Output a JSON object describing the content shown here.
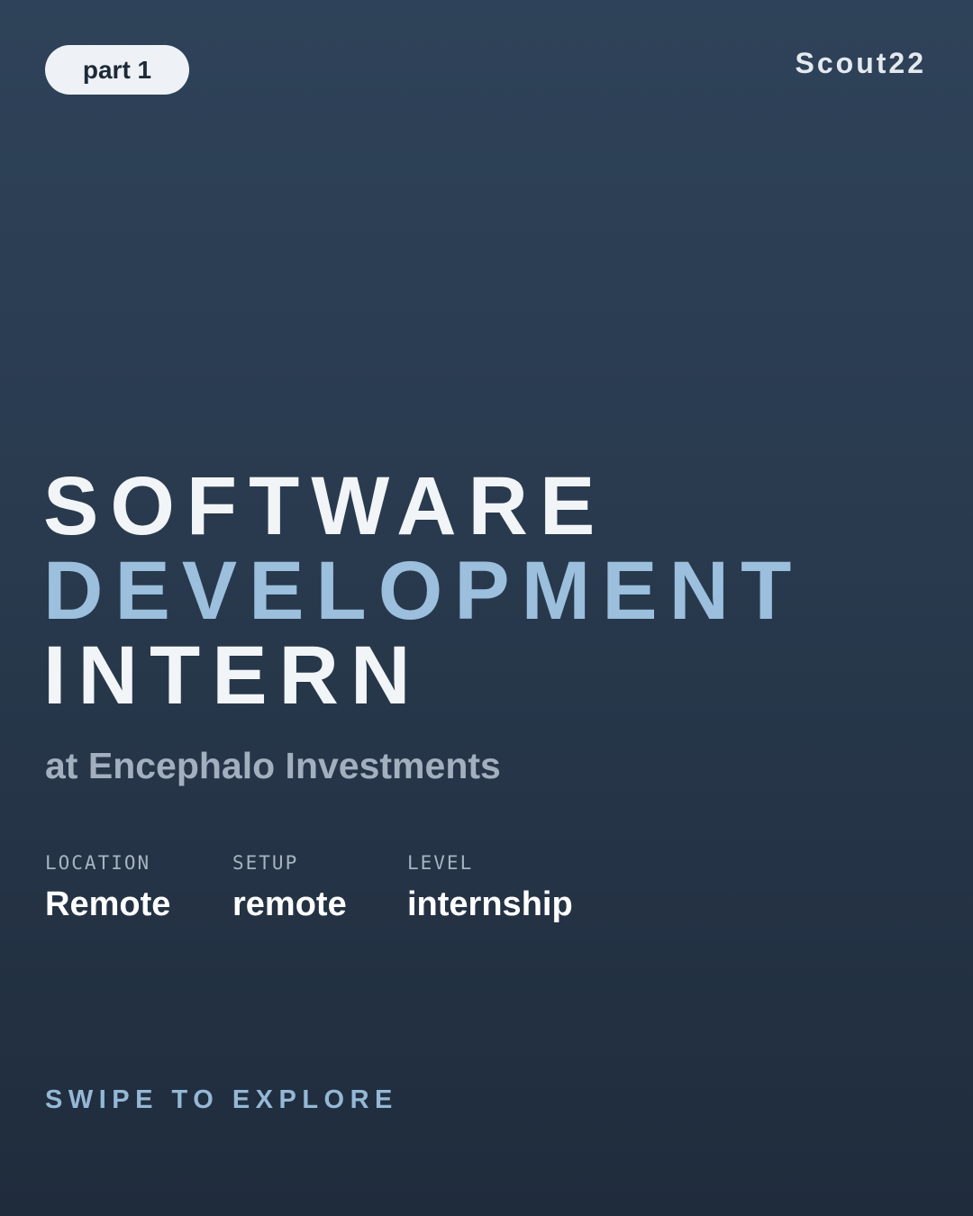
{
  "header": {
    "badge": "part 1",
    "brand": "Scout22"
  },
  "job": {
    "title_lines": [
      "SOFTWARE",
      "DEVELOPMENT",
      "INTERN"
    ],
    "company": "at Encephalo Investments"
  },
  "details": [
    {
      "label": "LOCATION",
      "value": "Remote"
    },
    {
      "label": "SETUP",
      "value": "remote"
    },
    {
      "label": "LEVEL",
      "value": "internship"
    }
  ],
  "cta": "SWIPE TO EXPLORE",
  "colors": {
    "background_top": "#2e4259",
    "background_bottom": "#1f2c3c",
    "accent": "#9bbfdc",
    "text": "#f2f5f8"
  }
}
